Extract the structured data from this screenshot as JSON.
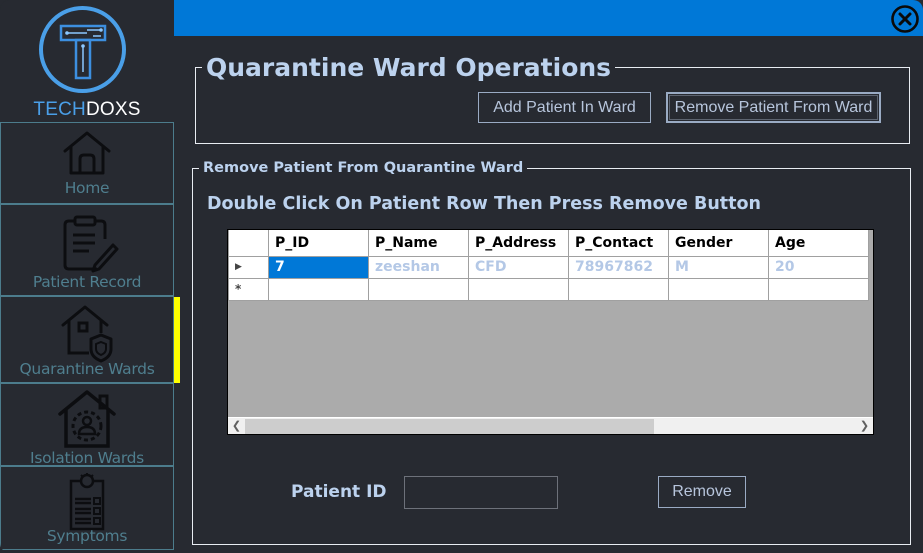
{
  "brand": {
    "part1": "TECH",
    "part2": "DOXS",
    "accent": "#4a9fe8"
  },
  "sidebar": {
    "items": [
      {
        "label": "Home",
        "icon": "home-icon"
      },
      {
        "label": "Patient Record",
        "icon": "clipboard-edit-icon"
      },
      {
        "label": "Quarantine Wards",
        "icon": "house-shield-icon",
        "active": true
      },
      {
        "label": "Isolation Wards",
        "icon": "house-person-icon"
      },
      {
        "label": "Symptoms",
        "icon": "checklist-virus-icon"
      }
    ],
    "active_indicator_color": "#ffff00"
  },
  "header": {
    "bar_color": "#0078d7",
    "close_icon": "close-circle-icon"
  },
  "operations": {
    "title": "Quarantine Ward Operations",
    "add_button": "Add Patient In Ward",
    "remove_button": "Remove Patient From Ward"
  },
  "remove_section": {
    "title": "Remove Patient From Quarantine Ward",
    "instruction": "Double Click On Patient Row Then Press Remove Button",
    "grid": {
      "columns": [
        "P_ID",
        "P_Name",
        "P_Address",
        "P_Contact",
        "Gender",
        "Age"
      ],
      "rows": [
        [
          "7",
          "zeeshan",
          "CFD",
          "78967862",
          "M",
          "20"
        ]
      ],
      "current_row_marker": "▶",
      "new_row_marker": "*"
    },
    "patient_id_label": "Patient ID",
    "patient_id_value": "",
    "remove_button": "Remove"
  }
}
